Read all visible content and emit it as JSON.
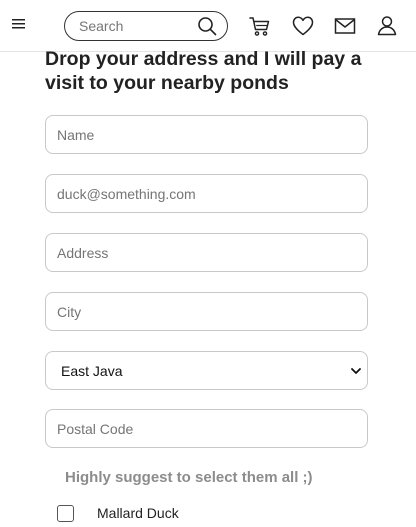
{
  "header": {
    "search_placeholder": "Search",
    "icons": [
      "menu-icon",
      "search-icon",
      "cart-icon",
      "heart-icon",
      "mail-icon",
      "user-icon"
    ]
  },
  "form": {
    "title": "Drop your address and I will pay a visit to your nearby ponds",
    "name_placeholder": "Name",
    "email_placeholder": "duck@something.com",
    "address_placeholder": "Address",
    "city_placeholder": "City",
    "province_selected": "East Java",
    "postal_placeholder": "Postal Code",
    "suggestion": "Highly suggest to select them all ;)",
    "options": [
      {
        "label": "Mallard Duck",
        "checked": false
      }
    ]
  },
  "colors": {
    "text": "#222222",
    "muted": "#8c8c8c",
    "border": "#c9c9c9"
  }
}
